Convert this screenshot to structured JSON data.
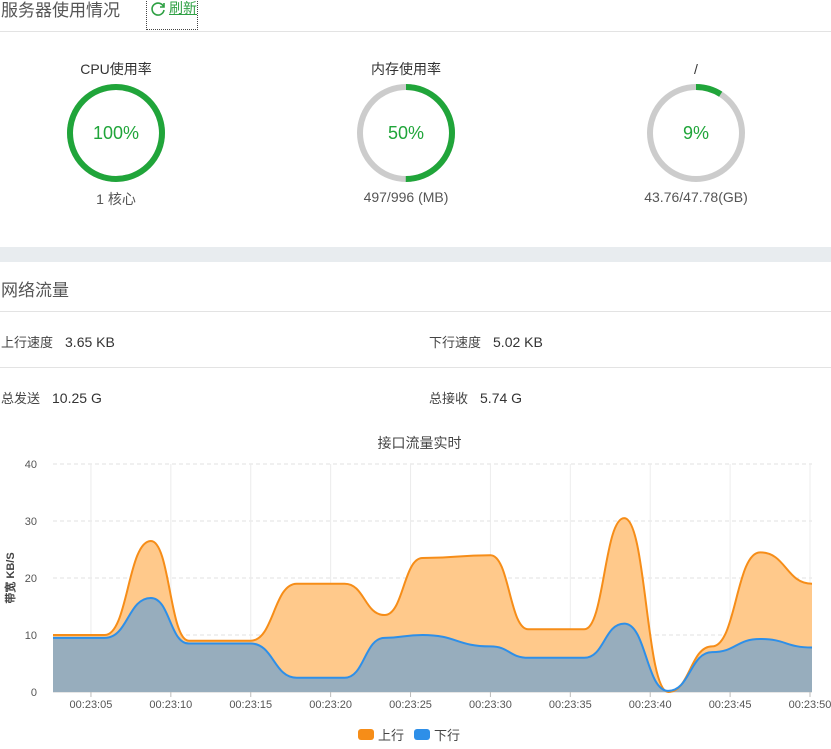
{
  "header": {
    "title": "服务器使用情况",
    "refresh_label": "刷新"
  },
  "gauges": [
    {
      "label": "CPU使用率",
      "value_text": "100%",
      "percent": 100,
      "sub": "1 核心"
    },
    {
      "label": "内存使用率",
      "value_text": "50%",
      "percent": 50,
      "sub": "497/996 (MB)"
    },
    {
      "label": "/",
      "value_text": "9%",
      "percent": 9,
      "sub": "43.76/47.78(GB)"
    }
  ],
  "network": {
    "title": "网络流量",
    "up_speed_label": "上行速度",
    "up_speed_value": "3.65 KB",
    "down_speed_label": "下行速度",
    "down_speed_value": "5.02 KB",
    "total_sent_label": "总发送",
    "total_sent_value": "10.25 G",
    "total_recv_label": "总接收",
    "total_recv_value": "5.74 G"
  },
  "colors": {
    "accent": "#20a53a",
    "ring_bg": "#cccccc",
    "up": "#f68d18",
    "down": "#2e8fe8",
    "up_fill": "#ffc98b",
    "down_fill": "#97adbd"
  },
  "chart_data": {
    "type": "area",
    "title": "接口流量实时",
    "ylabel": "带宽 KB/S",
    "ylim": [
      0,
      40
    ],
    "yticks": [
      0,
      10,
      20,
      30,
      40
    ],
    "x": [
      0,
      1,
      2,
      3,
      4,
      5,
      6,
      7,
      8,
      9,
      10,
      11,
      12,
      13,
      14,
      15,
      16,
      17,
      18,
      19
    ],
    "xlim": [
      0,
      19
    ],
    "xticks": [
      {
        "x": 0.95,
        "label": "00:23:05"
      },
      {
        "x": 2.95,
        "label": "00:23:10"
      },
      {
        "x": 4.95,
        "label": "00:23:15"
      },
      {
        "x": 6.95,
        "label": "00:23:20"
      },
      {
        "x": 8.95,
        "label": "00:23:25"
      },
      {
        "x": 10.95,
        "label": "00:23:30"
      },
      {
        "x": 12.95,
        "label": "00:23:35"
      },
      {
        "x": 14.95,
        "label": "00:23:40"
      },
      {
        "x": 16.95,
        "label": "00:23:45"
      },
      {
        "x": 18.95,
        "label": "00:23:50"
      }
    ],
    "series": [
      {
        "name": "上行",
        "values": [
          10,
          10,
          26.5,
          9,
          9,
          19,
          19,
          13.5,
          23.5,
          24,
          11,
          11,
          30.5,
          0,
          8,
          24.5,
          19
        ]
      },
      {
        "name": "下行",
        "values": [
          9.5,
          9.5,
          16.5,
          8.5,
          8.5,
          2.5,
          2.5,
          9.5,
          10,
          8,
          6,
          6,
          12,
          0.2,
          7,
          9.3,
          7.8
        ]
      }
    ],
    "series_x": [
      0,
      1.3,
      2.45,
      3.4,
      4.95,
      6.1,
      7.3,
      8.3,
      9.25,
      10.95,
      11.9,
      13.3,
      14.3,
      15.4,
      16.5,
      17.7,
      19
    ],
    "legend": "bottom"
  }
}
